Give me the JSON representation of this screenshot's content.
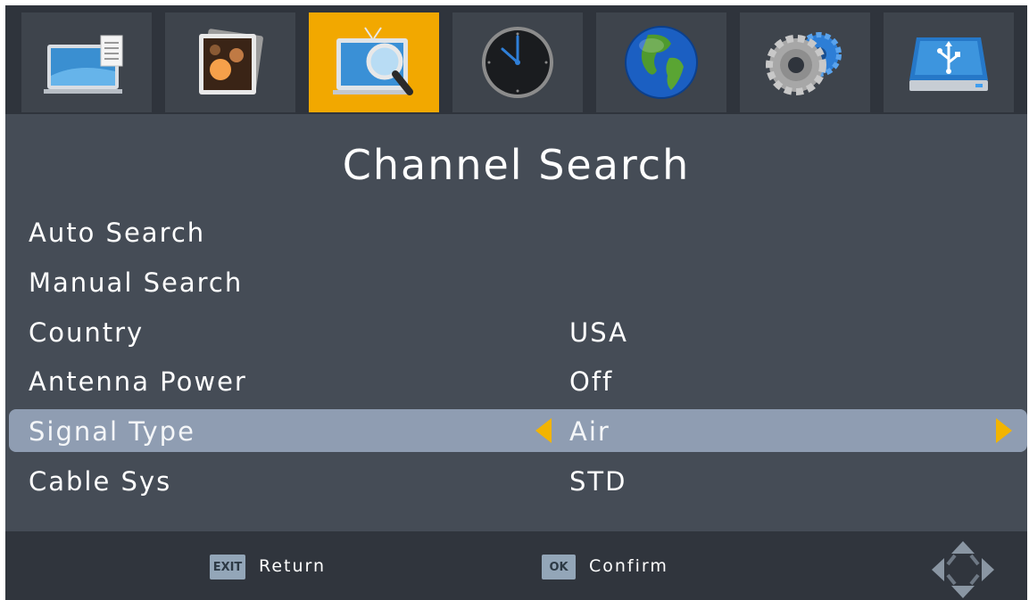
{
  "tabs": [
    {
      "icon": "tv-program-icon",
      "active": false
    },
    {
      "icon": "picture-icon",
      "active": false
    },
    {
      "icon": "channel-search-icon",
      "active": true
    },
    {
      "icon": "clock-icon",
      "active": false
    },
    {
      "icon": "globe-icon",
      "active": false
    },
    {
      "icon": "settings-gears-icon",
      "active": false
    },
    {
      "icon": "usb-drive-icon",
      "active": false
    }
  ],
  "page": {
    "title": "Channel Search"
  },
  "menu": {
    "items": [
      {
        "label": "Auto Search",
        "value": ""
      },
      {
        "label": "Manual Search",
        "value": ""
      },
      {
        "label": "Country",
        "value": "USA"
      },
      {
        "label": "Antenna Power",
        "value": "Off"
      },
      {
        "label": "Signal Type",
        "value": "Air",
        "selected": true
      },
      {
        "label": "Cable Sys",
        "value": "STD"
      }
    ]
  },
  "footer": {
    "exit_key": "EXIT",
    "exit_label": "Return",
    "ok_key": "OK",
    "ok_label": "Confirm"
  },
  "colors": {
    "accent": "#f2a800",
    "selection": "#8f9db2",
    "background": "#454c56"
  }
}
